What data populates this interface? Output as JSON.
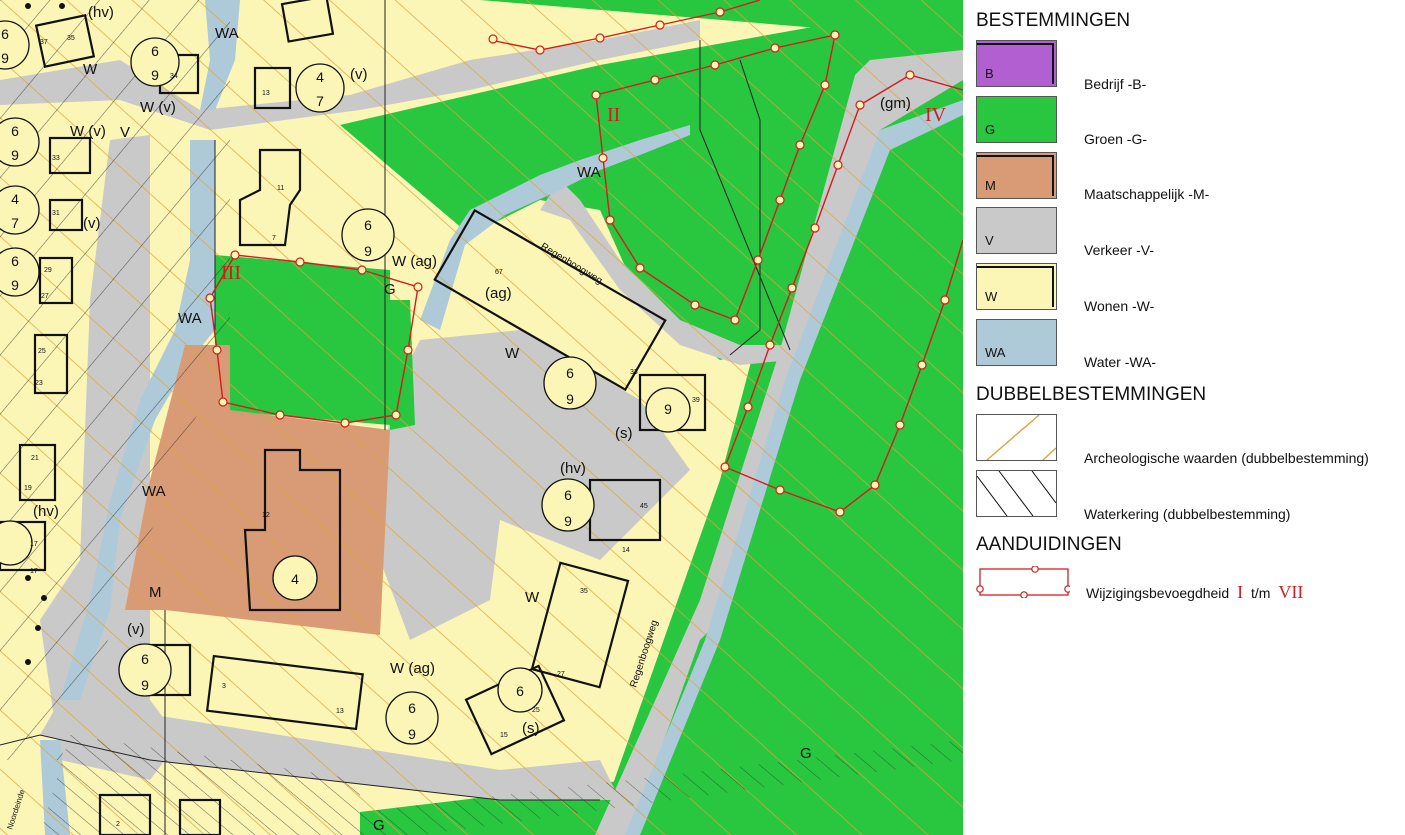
{
  "map": {
    "zone_labels": {
      "wa": "WA",
      "w": "W",
      "v": "V",
      "g": "G",
      "m": "M",
      "w_v": "W (v)",
      "w_ag": "W (ag)",
      "hv": "(hv)",
      "v_par": "(v)",
      "ag": "(ag)",
      "s": "(s)",
      "gm": "(gm)"
    },
    "street_names": [
      "Regenboogweg",
      "Regenboogweg",
      "Noordeinde"
    ],
    "roman_markers": [
      "II",
      "III",
      "IV"
    ],
    "house_numbers": [
      "37",
      "35",
      "34",
      "13",
      "11",
      "7",
      "33",
      "31",
      "29",
      "27",
      "25",
      "23",
      "21",
      "19",
      "17",
      "12",
      "67",
      "33",
      "15",
      "35",
      "27",
      "25",
      "15",
      "3",
      "13",
      "2",
      "17",
      "14",
      "45",
      "39"
    ],
    "height_symbol": {
      "top": "6",
      "bottom": "9"
    },
    "alt_symbols": [
      {
        "top": "4",
        "bottom": "7"
      },
      {
        "top": "4",
        "bottom": "7"
      },
      {
        "top": "",
        "bottom": "4"
      },
      {
        "top": "6",
        "bottom": ""
      }
    ]
  },
  "legend": {
    "heading_bestemmingen": "BESTEMMINGEN",
    "heading_dubbel": "DUBBELBESTEMMINGEN",
    "heading_aanduidingen": "AANDUIDINGEN",
    "items": [
      {
        "code": "B",
        "label": "Bedrijf -B-",
        "color": "#b15fd1"
      },
      {
        "code": "G",
        "label": "Groen -G-",
        "color": "#29c640"
      },
      {
        "code": "M",
        "label": "Maatschappelijk -M-",
        "color": "#d99b76"
      },
      {
        "code": "V",
        "label": "Verkeer -V-",
        "color": "#c9c9c9"
      },
      {
        "code": "W",
        "label": "Wonen -W-",
        "color": "#fcf6b6"
      },
      {
        "code": "WA",
        "label": "Water -WA-",
        "color": "#aecad9"
      }
    ],
    "double_items": [
      {
        "label": "Archeologische waarden (dubbelbestemming)",
        "line_color": "#d9a63b"
      },
      {
        "label": "Waterkering (dubbelbestemming)",
        "line_color": "#111111"
      }
    ],
    "annotation": {
      "label": "Wijzigingsbevoegdheid",
      "from": "I",
      "sep": "t/m",
      "to": "VII",
      "color": "#d41c1c"
    }
  }
}
